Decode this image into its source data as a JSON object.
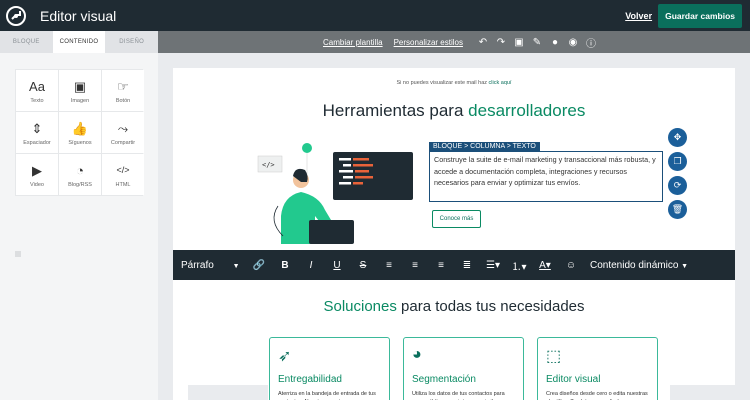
{
  "header": {
    "title": "Editor visual",
    "back_label": "Volver",
    "save_label": "Guardar cambios"
  },
  "tabs": [
    "BLOQUE",
    "CONTENIDO",
    "DISEÑO"
  ],
  "toolbar": {
    "change_template": "Cambiar plantilla",
    "customize_styles": "Personalizar estilos",
    "icons": [
      "undo-icon",
      "redo-icon",
      "save-icon",
      "attach-icon",
      "drop-icon",
      "preview-icon",
      "info-icon"
    ]
  },
  "blocks": [
    {
      "label": "Texto",
      "icon": "Aa"
    },
    {
      "label": "Imagen",
      "icon": "▣"
    },
    {
      "label": "Botón",
      "icon": "☞"
    },
    {
      "label": "Espaciador",
      "icon": "⇕"
    },
    {
      "label": "Síguenos",
      "icon": "👍"
    },
    {
      "label": "Compartir",
      "icon": "⤳"
    },
    {
      "label": "Video",
      "icon": "▶"
    },
    {
      "label": "Blog/RSS",
      "icon": "◔"
    },
    {
      "label": "HTML",
      "icon": "</>"
    }
  ],
  "email": {
    "preheader_text": "Si no puedes visualizar este mail haz",
    "preheader_link": "click aquí",
    "headline_part1": "Herramientas para ",
    "headline_accent": "desarrolladores",
    "breadcrumb": "BLOQUE > COLUMNA > TEXTO",
    "body_text": "Construye la suite de e-mail marketing y transaccional más robusta, y accede a documentación completa, integraciones y recursos necesarios para enviar y optimizar tus envíos.",
    "cta_label": "Conoce más",
    "section_title_accent": "Soluciones",
    "section_title_rest": " para todas tus necesidades",
    "cards": [
      {
        "title": "Entregabilidad",
        "icon": "paper-plane-icon",
        "desc": "Aterriza en la bandeja de entrada de tus contactos. Nuestro secreto: infraestructura y asesoramiento"
      },
      {
        "title": "Segmentación",
        "icon": "pie-chart-icon",
        "desc": "Utiliza los datos de tus contactos para crear públicos con intereses similares. Optimiza tus envíos"
      },
      {
        "title": "Editor visual",
        "icon": "cursor-icon",
        "desc": "Crea diseños desde cero o edita nuestras plantillas. Tendrás un resultado profesional siempre"
      }
    ]
  },
  "rich_text": {
    "paragraph": "Párrafo",
    "dynamic": "Contenido dinámico"
  }
}
